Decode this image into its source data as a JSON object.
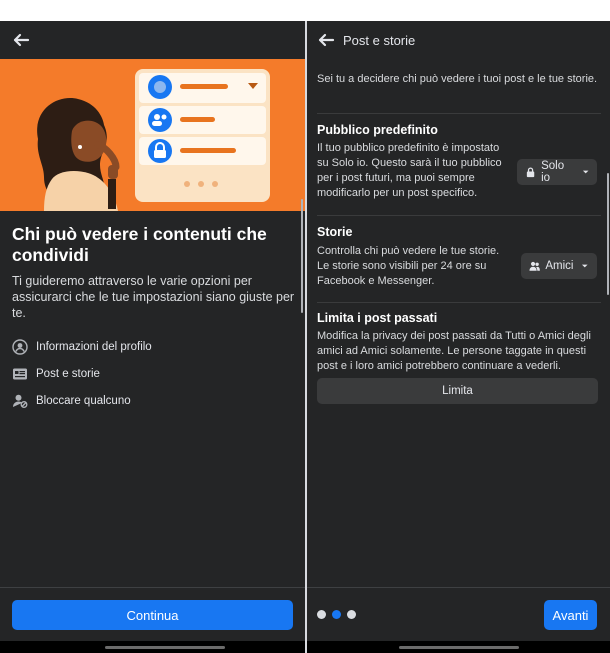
{
  "left": {
    "heading": "Chi può vedere i contenuti che condividi",
    "subtext": "Ti guideremo attraverso le varie opzioni per assicurarci che le tue impostazioni siano giuste per te.",
    "topics": [
      {
        "label": "Informazioni del profilo",
        "icon": "profile-circle-icon"
      },
      {
        "label": "Post e storie",
        "icon": "post-card-icon"
      },
      {
        "label": "Bloccare qualcuno",
        "icon": "block-person-icon"
      }
    ],
    "continue_label": "Continua"
  },
  "right": {
    "title": "Post e storie",
    "intro": "Sei tu a decidere chi può vedere i tuoi post e le tue storie.",
    "default_audience": {
      "title": "Pubblico predefinito",
      "text": "Il tuo pubblico predefinito è impostato su Solo io. Questo sarà il tuo pubblico per i post futuri, ma puoi sempre modificarlo per un post specifico.",
      "button_label": "Solo io"
    },
    "stories": {
      "title": "Storie",
      "text": "Controlla chi può vedere le tue storie. Le storie sono visibili per 24 ore su Facebook e Messenger.",
      "button_label": "Amici"
    },
    "limit_past": {
      "title": "Limita i post passati",
      "text": "Modifica la privacy dei post passati da Tutti o Amici degli amici ad Amici solamente. Le persone taggate in questi post e i loro amici potrebbero continuare a vederli.",
      "button_label": "Limita"
    },
    "pagination": {
      "total": 3,
      "active_index": 1
    },
    "next_label": "Avanti"
  },
  "colors": {
    "background": "#242526",
    "accent_blue": "#1877f2",
    "hero_orange": "#f47b2a",
    "button_gray": "#3a3b3c"
  }
}
